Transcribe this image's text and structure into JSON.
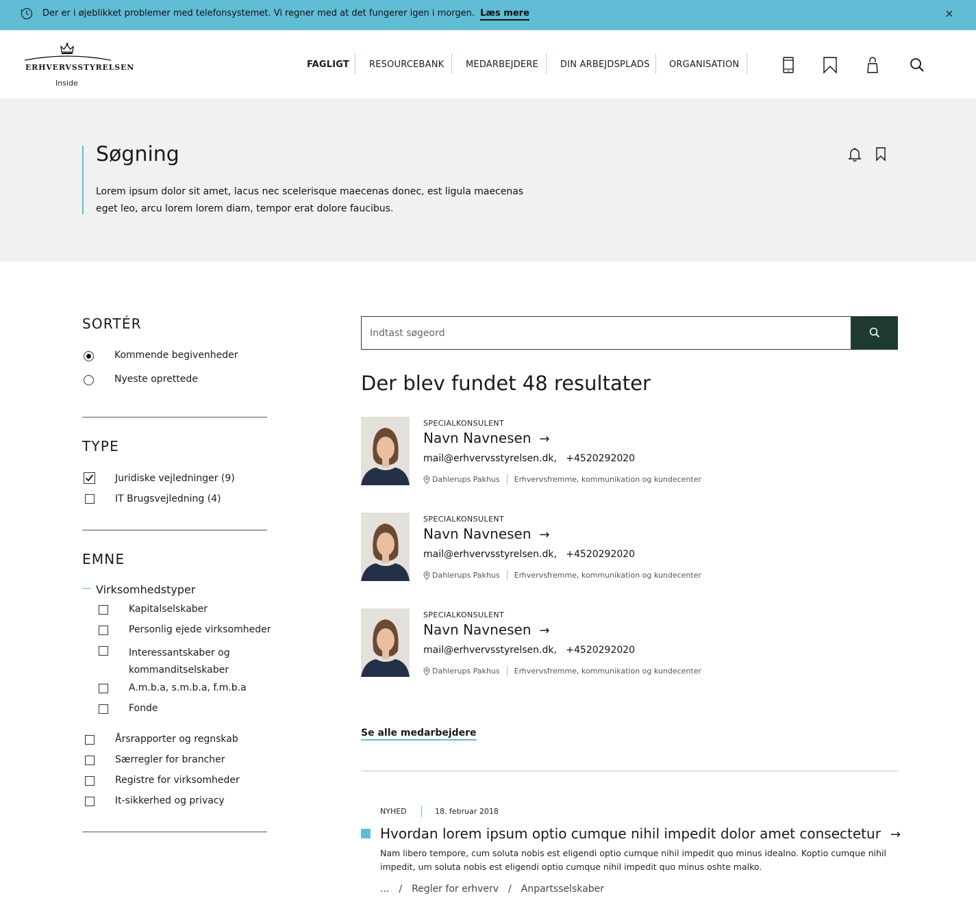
{
  "alert": {
    "message": "Der er i øjeblikket problemer med telefonsystemet. Vi regner med at det fungerer igen i morgen.",
    "link": "Læs mere",
    "close": "×"
  },
  "header": {
    "logo_text": "ERHVERVSSTYRELSEN",
    "logo_sub": "Inside",
    "nav": [
      "FAGLIGT",
      "RESOURCEBANK",
      "MEDARBEJDERE",
      "DIN ARBEJDSPLADS",
      "ORGANISATION"
    ],
    "icons": [
      "phone-icon",
      "bookmark-icon",
      "user-icon",
      "search-icon"
    ]
  },
  "hero": {
    "title": "Søgning",
    "text": "Lorem ipsum dolor sit amet, lacus nec scelerisque maecenas donec, est ligula maecenas eget leo, arcu lorem lorem diam, tempor erat dolore faucibus."
  },
  "sidebar": {
    "sort_heading": "SORTÉR",
    "sort_options": [
      "Kommende begivenheder",
      "Nyeste oprettede"
    ],
    "type_heading": "TYPE",
    "type_options": [
      "Juridiske vejledninger (9)",
      "IT Brugsvejledning (4)"
    ],
    "emne_heading": "EMNE",
    "emne_group": "Virksomhedstyper",
    "emne_sub": [
      "Kapitalselskaber",
      "Personlig ejede virksomheder",
      "Interessantskaber og kommanditselskaber",
      "A.m.b.a, s.m.b.a, f.m.b.a",
      "Fonde"
    ],
    "emne_other": [
      "Årsrapporter og regnskab",
      "Særregler for brancher",
      "Registre for virksomheder",
      "It-sikkerhed og privacy"
    ]
  },
  "search": {
    "placeholder": "Indtast søgeord",
    "results_heading": "Der blev fundet 48 resultater"
  },
  "people": [
    {
      "role": "SPECIALKONSULENT",
      "name": "Navn Navnesen",
      "email": "mail@erhvervsstyrelsen.dk,",
      "phone": "+4520292020",
      "location": "Dahlerups Pakhus",
      "department": "Erhvervsfremme, kommunikation og kundecenter"
    },
    {
      "role": "SPECIALKONSULENT",
      "name": "Navn Navnesen",
      "email": "mail@erhvervsstyrelsen.dk,",
      "phone": "+4520292020",
      "location": "Dahlerups Pakhus",
      "department": "Erhvervsfremme, kommunikation og kundecenter"
    },
    {
      "role": "SPECIALKONSULENT",
      "name": "Navn Navnesen",
      "email": "mail@erhvervsstyrelsen.dk,",
      "phone": "+4520292020",
      "location": "Dahlerups Pakhus",
      "department": "Erhvervsfremme, kommunikation og kundecenter"
    }
  ],
  "see_all": "Se alle medarbejdere",
  "news": {
    "tag": "NYHED",
    "date": "18. februar 2018",
    "title": "Hvordan lorem ipsum optio cumque nihil impedit dolor amet consectetur",
    "body": "Nam libero tempore, cum soluta nobis est eligendi optio cumque nihil impedit quo minus idealno. Koptio cumque nihil impedit, um soluta nobis est eligendi optio cumque nihil impedit quo minus oshte malko.",
    "breadcrumb": [
      "...",
      "Regler for erhverv",
      "Anpartsselskaber"
    ]
  },
  "colors": {
    "accent": "#61bcd5",
    "dark_green": "#1f3a32",
    "hero_bg": "#f0f1f0"
  }
}
